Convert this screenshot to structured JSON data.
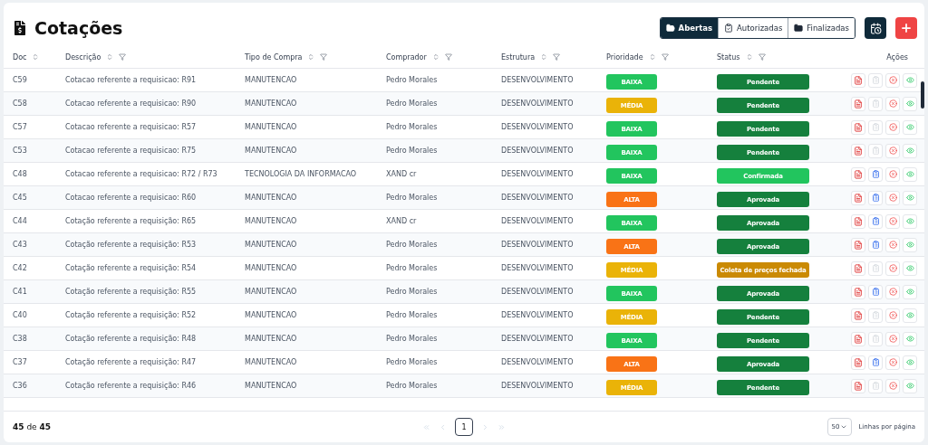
{
  "header": {
    "title": "Cotações",
    "tabs": [
      {
        "label": "Abertas",
        "selected": true,
        "kind": "open"
      },
      {
        "label": "Autorizadas",
        "selected": false,
        "kind": "authorized"
      },
      {
        "label": "Finalizadas",
        "selected": false,
        "kind": "done"
      }
    ]
  },
  "table": {
    "columns": [
      {
        "label": "Doc",
        "sortable": true,
        "filterable": false
      },
      {
        "label": "Descrição",
        "sortable": true,
        "filterable": true
      },
      {
        "label": "Tipo de Compra",
        "sortable": true,
        "filterable": true
      },
      {
        "label": "Comprador",
        "sortable": true,
        "filterable": true
      },
      {
        "label": "Estrutura",
        "sortable": true,
        "filterable": true
      },
      {
        "label": "Prioridade",
        "sortable": true,
        "filterable": true
      },
      {
        "label": "Status",
        "sortable": true,
        "filterable": true
      },
      {
        "label": "Ações",
        "sortable": false,
        "filterable": false
      }
    ],
    "rows": [
      {
        "doc": "C59",
        "description": "Cotacao referente a requisicao: R91",
        "purchase_type": "MANUTENCAO",
        "buyer": "Pedro Morales",
        "structure": "DESENVOLVIMENTO",
        "priority": {
          "label": "BAIXA",
          "color": "#22c55e"
        },
        "status": {
          "label": "Pendente",
          "color": "#15803d"
        },
        "clipboard_disabled": true
      },
      {
        "doc": "C58",
        "description": "Cotacao referente a requisicao: R90",
        "purchase_type": "MANUTENCAO",
        "buyer": "Pedro Morales",
        "structure": "DESENVOLVIMENTO",
        "priority": {
          "label": "MÉDIA",
          "color": "#eab308"
        },
        "status": {
          "label": "Pendente",
          "color": "#15803d"
        },
        "clipboard_disabled": true
      },
      {
        "doc": "C57",
        "description": "Cotacao referente a requisicao: R57",
        "purchase_type": "MANUTENCAO",
        "buyer": "Pedro Morales",
        "structure": "DESENVOLVIMENTO",
        "priority": {
          "label": "BAIXA",
          "color": "#22c55e"
        },
        "status": {
          "label": "Pendente",
          "color": "#15803d"
        },
        "clipboard_disabled": true
      },
      {
        "doc": "C53",
        "description": "Cotacao referente a requisicao: R75",
        "purchase_type": "MANUTENCAO",
        "buyer": "Pedro Morales",
        "structure": "DESENVOLVIMENTO",
        "priority": {
          "label": "BAIXA",
          "color": "#22c55e"
        },
        "status": {
          "label": "Pendente",
          "color": "#15803d"
        },
        "clipboard_disabled": true
      },
      {
        "doc": "C48",
        "description": "Cotacao referente a requisicao: R72 / R73",
        "purchase_type": "TECNOLOGIA DA INFORMACAO",
        "buyer": "XAND cr",
        "structure": "DESENVOLVIMENTO",
        "priority": {
          "label": "BAIXA",
          "color": "#22c55e"
        },
        "status": {
          "label": "Confirmada",
          "color": "#22c55e"
        },
        "clipboard_disabled": false
      },
      {
        "doc": "C45",
        "description": "Cotacao referente a requisicao: R60",
        "purchase_type": "MANUTENCAO",
        "buyer": "Pedro Morales",
        "structure": "DESENVOLVIMENTO",
        "priority": {
          "label": "ALTA",
          "color": "#f97316"
        },
        "status": {
          "label": "Aprovada",
          "color": "#15803d"
        },
        "clipboard_disabled": false
      },
      {
        "doc": "C44",
        "description": "Cotação referente a requisição: R65",
        "purchase_type": "MANUTENCAO",
        "buyer": "XAND cr",
        "structure": "DESENVOLVIMENTO",
        "priority": {
          "label": "BAIXA",
          "color": "#22c55e"
        },
        "status": {
          "label": "Aprovada",
          "color": "#15803d"
        },
        "clipboard_disabled": false
      },
      {
        "doc": "C43",
        "description": "Cotação referente a requisição: R53",
        "purchase_type": "MANUTENCAO",
        "buyer": "Pedro Morales",
        "structure": "DESENVOLVIMENTO",
        "priority": {
          "label": "ALTA",
          "color": "#f97316"
        },
        "status": {
          "label": "Aprovada",
          "color": "#15803d"
        },
        "clipboard_disabled": false
      },
      {
        "doc": "C42",
        "description": "Cotação referente a requisição: R54",
        "purchase_type": "MANUTENCAO",
        "buyer": "Pedro Morales",
        "structure": "DESENVOLVIMENTO",
        "priority": {
          "label": "MÉDIA",
          "color": "#eab308"
        },
        "status": {
          "label": "Coleta de preços fechada",
          "color": "#ca8a04"
        },
        "clipboard_disabled": true
      },
      {
        "doc": "C41",
        "description": "Cotação referente a requisição: R55",
        "purchase_type": "MANUTENCAO",
        "buyer": "Pedro Morales",
        "structure": "DESENVOLVIMENTO",
        "priority": {
          "label": "BAIXA",
          "color": "#22c55e"
        },
        "status": {
          "label": "Aprovada",
          "color": "#15803d"
        },
        "clipboard_disabled": false
      },
      {
        "doc": "C40",
        "description": "Cotação referente a requisição: R52",
        "purchase_type": "MANUTENCAO",
        "buyer": "Pedro Morales",
        "structure": "DESENVOLVIMENTO",
        "priority": {
          "label": "MÉDIA",
          "color": "#eab308"
        },
        "status": {
          "label": "Pendente",
          "color": "#15803d"
        },
        "clipboard_disabled": true
      },
      {
        "doc": "C38",
        "description": "Cotação referente a requisição: R48",
        "purchase_type": "MANUTENCAO",
        "buyer": "Pedro Morales",
        "structure": "DESENVOLVIMENTO",
        "priority": {
          "label": "BAIXA",
          "color": "#22c55e"
        },
        "status": {
          "label": "Pendente",
          "color": "#15803d"
        },
        "clipboard_disabled": true
      },
      {
        "doc": "C37",
        "description": "Cotação referente a requisição: R47",
        "purchase_type": "MANUTENCAO",
        "buyer": "Pedro Morales",
        "structure": "DESENVOLVIMENTO",
        "priority": {
          "label": "ALTA",
          "color": "#f97316"
        },
        "status": {
          "label": "Aprovada",
          "color": "#15803d"
        },
        "clipboard_disabled": false
      },
      {
        "doc": "C36",
        "description": "Cotação referente a requisição: R46",
        "purchase_type": "MANUTENCAO",
        "buyer": "Pedro Morales",
        "structure": "DESENVOLVIMENTO",
        "priority": {
          "label": "MÉDIA",
          "color": "#eab308"
        },
        "status": {
          "label": "Pendente",
          "color": "#15803d"
        },
        "clipboard_disabled": true
      }
    ]
  },
  "footer": {
    "count": "**45** de **45**",
    "pages": [
      {
        "label": "1",
        "selected": true
      }
    ],
    "page_size": "50",
    "page_size_label": "Linhas por página"
  }
}
